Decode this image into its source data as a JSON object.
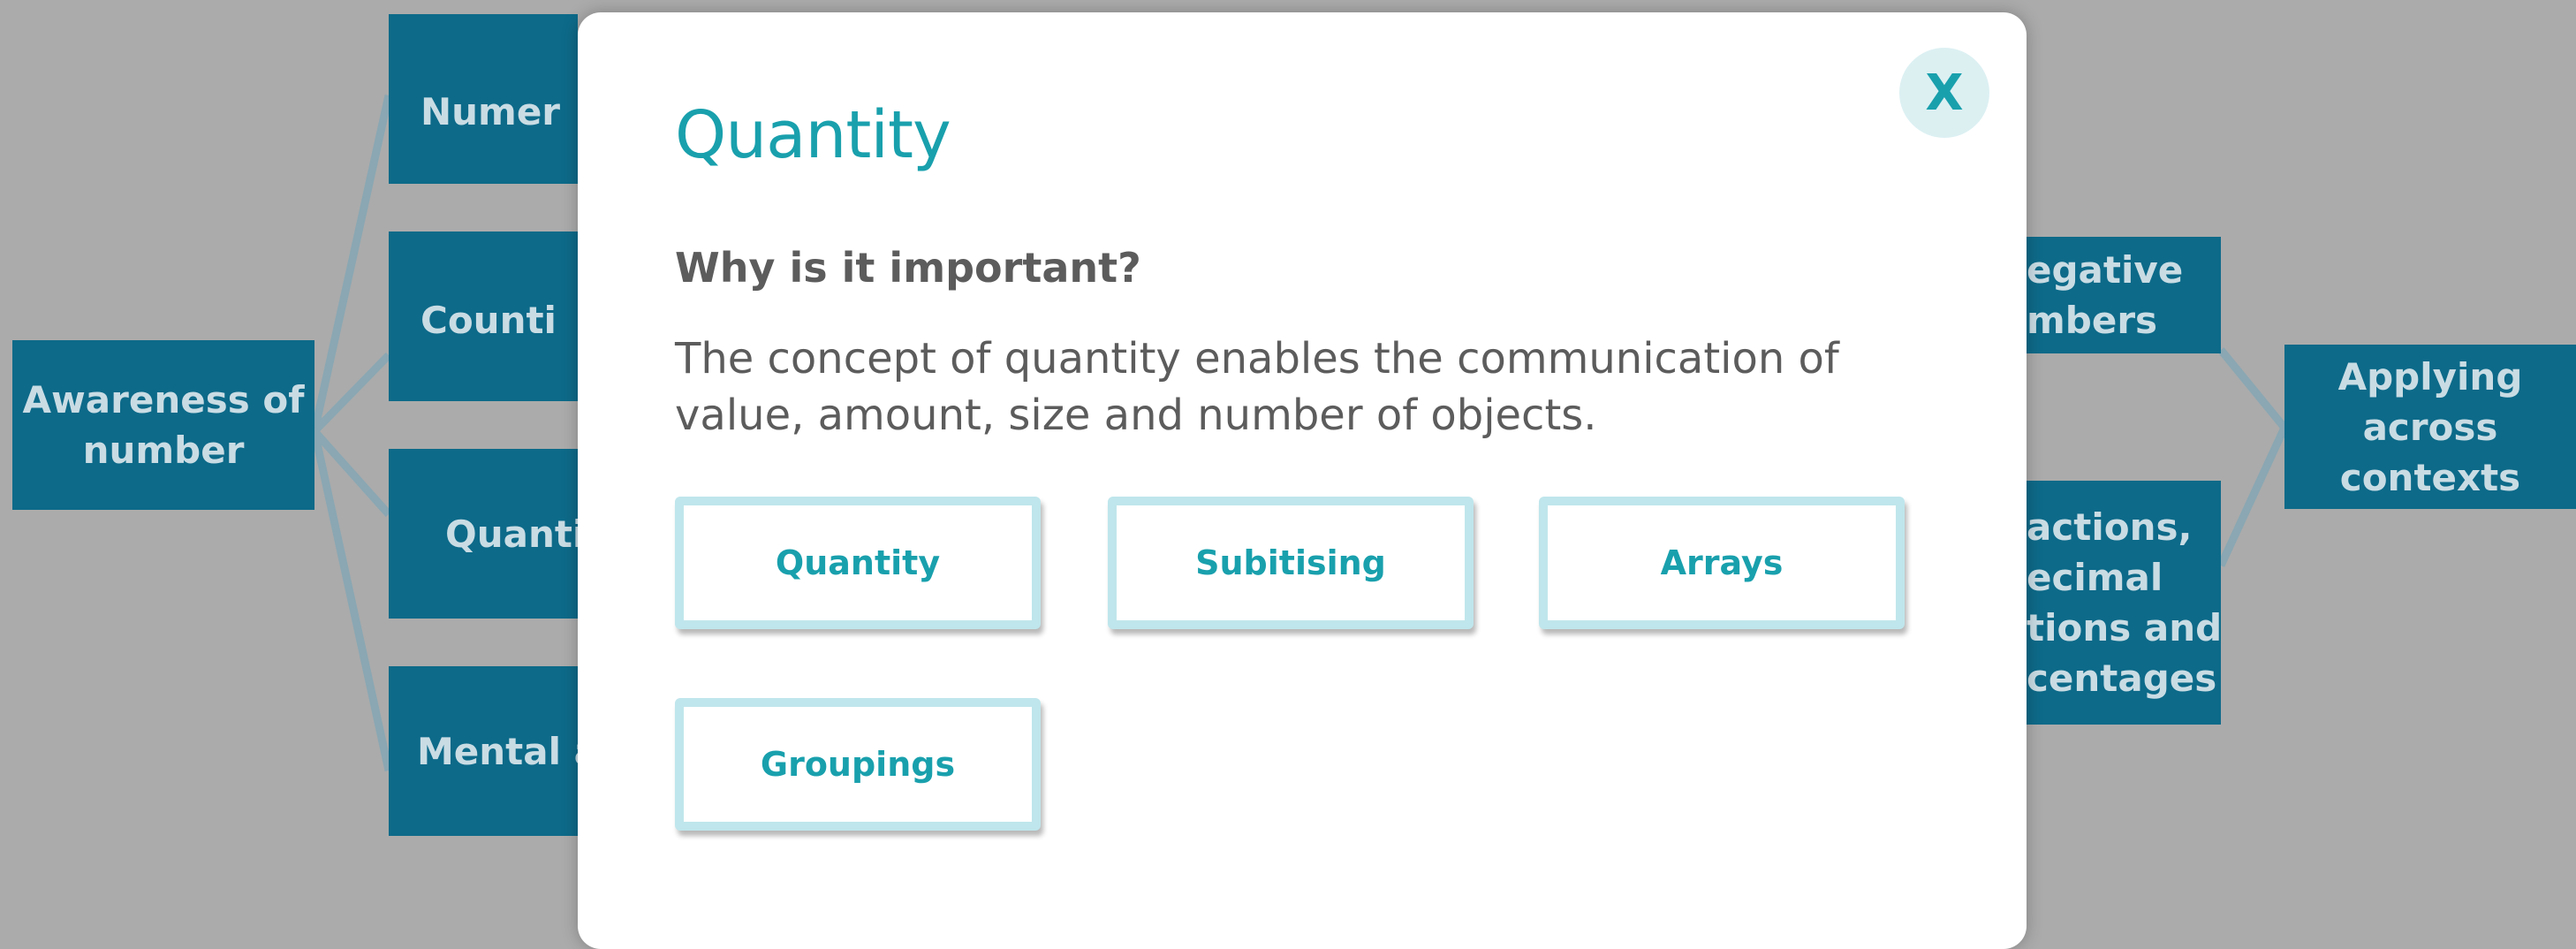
{
  "diagram": {
    "nodes": {
      "awareness": [
        "Awareness of",
        "number"
      ],
      "numeral": "Numer",
      "counting": "Counti",
      "quantity": "Quantit",
      "mental": "Mental ag",
      "negative": [
        "egative",
        "mbers"
      ],
      "fractions": [
        "actions,",
        "ecimal",
        "tions and",
        "centages"
      ],
      "applying": [
        "Applying",
        "across",
        "contexts"
      ]
    }
  },
  "modal": {
    "title": "Quantity",
    "close_label": "X",
    "heading": "Why is it important?",
    "description": "The concept of quantity enables the communication of value, amount, size and number of objects.",
    "buttons": [
      "Quantity",
      "Subitising",
      "Arrays",
      "Groupings"
    ]
  },
  "colors": {
    "overlay_background": "#ababab",
    "node": "#0d6a89",
    "accent": "#19a0ad",
    "button_border": "#bfe6ec"
  }
}
